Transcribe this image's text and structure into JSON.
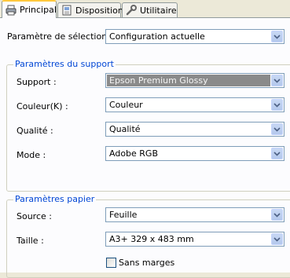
{
  "tabs": [
    {
      "label": "Principal",
      "icon": "printer-icon"
    },
    {
      "label": "Disposition",
      "icon": "page-layout-icon"
    },
    {
      "label": "Utilitaire",
      "icon": "wrench-icon"
    }
  ],
  "selection": {
    "label": "Paramètre de sélection :",
    "value": "Configuration actuelle"
  },
  "support_group": {
    "title": "Paramètres du support",
    "support": {
      "label": "Support :",
      "value": "Epson Premium Glossy"
    },
    "couleur": {
      "label": "Couleur(K) :",
      "value": "Couleur"
    },
    "qualite": {
      "label": "Qualité :",
      "value": "Qualité"
    },
    "mode": {
      "label": "Mode :",
      "value": "Adobe RGB"
    }
  },
  "paper_group": {
    "title": "Paramètres papier",
    "source": {
      "label": "Source :",
      "value": "Feuille"
    },
    "taille": {
      "label": "Taille :",
      "value": "A3+ 329 x 483 mm"
    },
    "sans_marges": {
      "label": "Sans marges",
      "checked": false
    }
  },
  "colors": {
    "accent": "#ffc83c",
    "group_title": "#0046d5",
    "combo_border": "#7f9db9"
  }
}
